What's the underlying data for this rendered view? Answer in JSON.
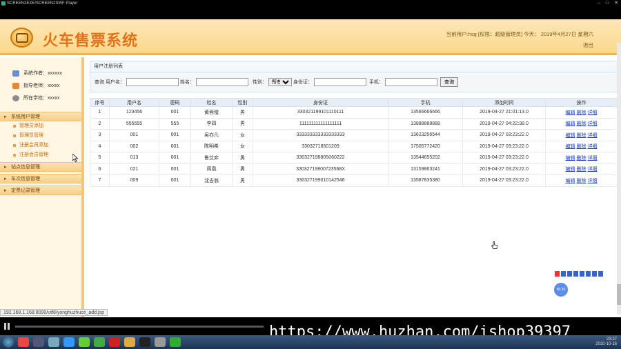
{
  "window": {
    "title": "SCREEN2EXE/SCREEN2SWF Player"
  },
  "header": {
    "app_title": "火车售票系统",
    "user_info": "当前用户:hsg [权限：超级管理员] 今天： 2019年4月27日 星期六",
    "logout": "退出"
  },
  "sidebar": {
    "info": [
      {
        "label": "系统作者：xxxxxx",
        "icon": "people-icon"
      },
      {
        "label": "指导老师：xxxxx",
        "icon": "teacher-icon"
      },
      {
        "label": "所在学校：xxxxx",
        "icon": "school-icon"
      }
    ],
    "group_user": "系统用户管理",
    "items_user": [
      "管理员添加",
      "管理员管理",
      "注册会员添加",
      "注册会员管理"
    ],
    "group_station": "站点信息管理",
    "group_train": "车次信息管理",
    "group_booking": "定票记录管理"
  },
  "panel": {
    "title": "用户注册列表",
    "search": {
      "label_query": "查询 用户名：",
      "label_name": "姓名：",
      "label_gender": "性别：",
      "gender_selected": "所有",
      "label_id": "身份证：",
      "label_phone": "手机：",
      "button": "查询"
    }
  },
  "table": {
    "headers": [
      "序号",
      "用户名",
      "密码",
      "姓名",
      "性别",
      "身份证",
      "手机",
      "添加时间",
      "操作"
    ],
    "actions": [
      "编辑",
      "删除",
      "详细"
    ],
    "rows": [
      [
        "1",
        "123456",
        "001",
        "黄蓉惺",
        "男",
        "330321199101110111",
        "13566666666",
        "2019-04-27 21:01:13.0"
      ],
      [
        "2",
        "555555",
        "555",
        "李四",
        "男",
        "111111111111111111",
        "13888888888",
        "2019-04-27 04:22:38.0"
      ],
      [
        "3",
        "001",
        "001",
        "吴亦凡",
        "女",
        "333333333333333333",
        "13623256544",
        "2019-04-27 03:23:22.0"
      ],
      [
        "4",
        "002",
        "001",
        "陈明希",
        "女",
        "33032718501209",
        "17505772420",
        "2019-04-27 03:23:22.0"
      ],
      [
        "5",
        "013",
        "001",
        "鲁艾弈",
        "男",
        "330327198805060222",
        "13544655202",
        "2019-04-27 03:23:22.0"
      ],
      [
        "6",
        "021",
        "001",
        "周凰",
        "男",
        "33032719800723568X",
        "13159863241",
        "2019-04-27 03:23:22.0"
      ],
      [
        "7",
        "009",
        "001",
        "沈吉翁",
        "男",
        "330327199010142546",
        "13587835380",
        "2019-04-27 03:23:22.0"
      ]
    ]
  },
  "status_url": "192.168.1.168:8090/utf8/yonghuzhuce_add.jsp",
  "ime_badge": "80.20",
  "watermark": "https://www.huzhan.com/ishop39397",
  "tray": {
    "time": "23:27",
    "date": "2020-10-16"
  }
}
